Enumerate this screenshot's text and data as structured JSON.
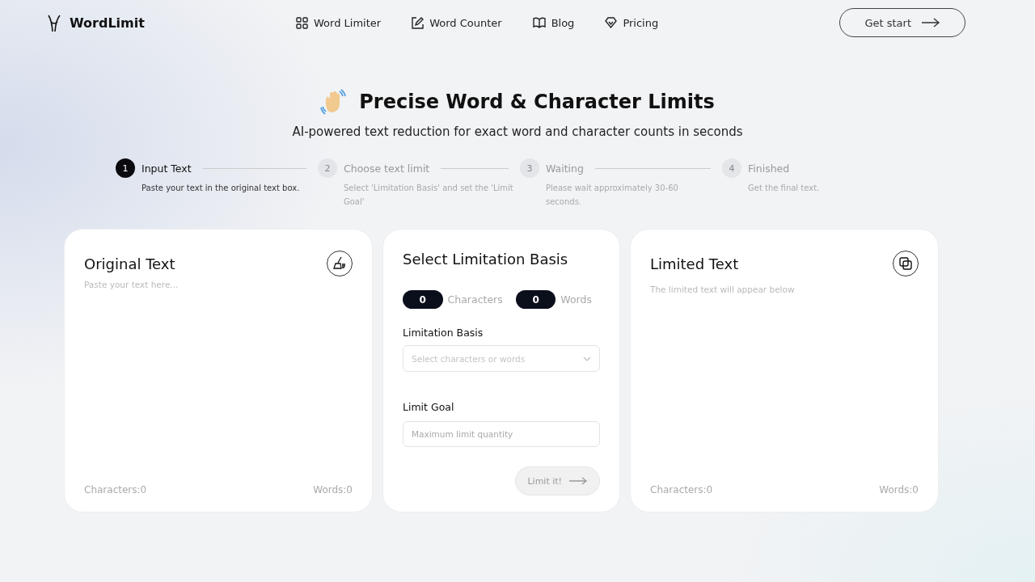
{
  "header": {
    "logo": "WordLimit",
    "nav": [
      {
        "label": "Word Limiter",
        "kind": "grid"
      },
      {
        "label": "Word Counter",
        "kind": "edit"
      },
      {
        "label": "Blog",
        "kind": "book"
      },
      {
        "label": "Pricing",
        "kind": "diamond"
      }
    ],
    "cta": "Get start"
  },
  "hero": {
    "title": "Precise Word & Character Limits",
    "subtitle": "AI-powered text reduction for exact word and character counts in seconds"
  },
  "steps": [
    {
      "number": "1",
      "title": "Input Text",
      "text": "Paste your text in the original text box.",
      "selected": true
    },
    {
      "number": "2",
      "title": "Choose text limit",
      "text": "Select 'Limitation Basis' and set the 'Limit Goal'",
      "selected": false
    },
    {
      "number": "3",
      "title": "Waiting",
      "text": "Please wait approximately 30-60 seconds.",
      "selected": false
    },
    {
      "number": "4",
      "title": "Finished",
      "text": "Get the final text.",
      "selected": false
    }
  ],
  "original": {
    "title": "Original Text",
    "placeholder": "Paste your text here...",
    "characters": "Characters:0",
    "words": "Words:0"
  },
  "basis": {
    "title": "Select Limitation Basis",
    "char_count": "0",
    "char_label": "Characters",
    "word_count": "0",
    "word_label": "Words",
    "basis_label": "Limitation Basis",
    "basis_placeholder": "Select characters or words",
    "goal_label": "Limit Goal",
    "goal_placeholder": "Maximum limit quantity",
    "button": {
      "label": "Limit it!",
      "disabled": true
    }
  },
  "limited": {
    "title": "Limited Text",
    "hint": "The limited text will appear below",
    "characters": "Characters:0",
    "words": "Words:0"
  }
}
